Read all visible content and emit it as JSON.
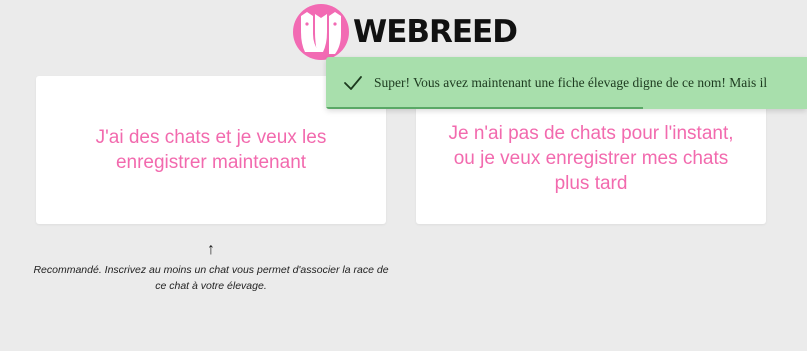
{
  "header": {
    "logo_text": "WEBREED",
    "logo_icon": "cat-dog-icon",
    "brand_color": "#f26ab3"
  },
  "options": [
    {
      "label": "J'ai des chats et je veux les enregistrer maintenant"
    },
    {
      "label": "Je n'ai pas de chats pour l'instant, ou je veux enregistrer mes chats plus tard"
    }
  ],
  "recommendation": {
    "arrow": "↑",
    "text": "Recommandé. Inscrivez au moins un chat vous permet d'associer la race de ce chat à votre élevage."
  },
  "toast": {
    "icon": "check-icon",
    "message": "Super! Vous avez maintenant une fiche élevage digne de ce nom! Mais il",
    "progress": 0.66,
    "color": "#a8dfac"
  }
}
